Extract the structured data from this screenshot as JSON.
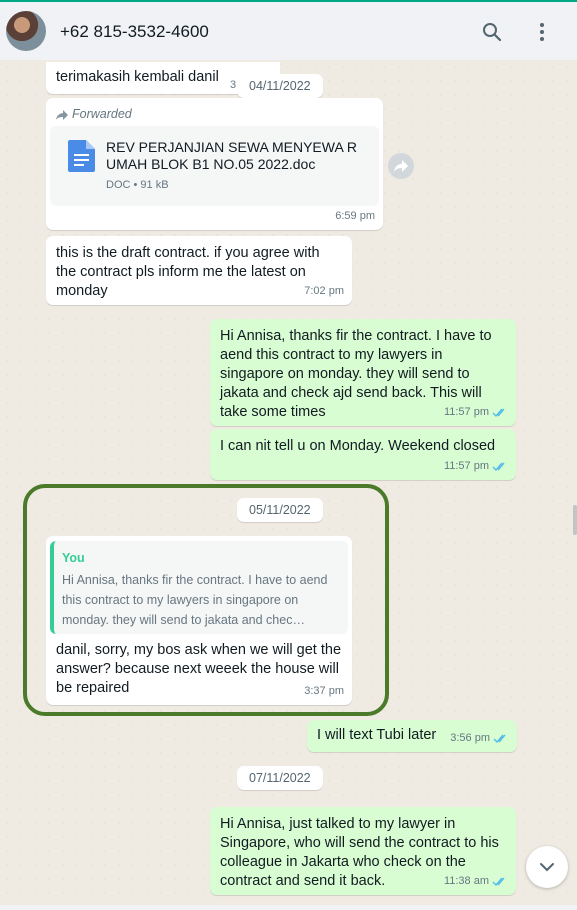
{
  "header": {
    "contact": "+62 815-3532-4600",
    "search_icon": "search-icon",
    "menu_icon": "kebab-menu-icon"
  },
  "colors": {
    "accent": "#00a884",
    "incoming_bubble": "#ffffff",
    "outgoing_bubble": "#d9fdd3",
    "read_ticks": "#53bdeb",
    "highlight_border": "#4a7a2a"
  },
  "messages": {
    "m1": {
      "text": "terimakasih kembali danil",
      "badge": "3"
    },
    "date1": "04/11/2022",
    "m2": {
      "forwarded": "Forwarded",
      "doc_name": "REV PERJANJIAN SEWA MENYEWA RUMAH BLOK B1 NO.05 2022.doc",
      "doc_meta": "DOC • 91 kB",
      "time": "6:59 pm"
    },
    "m3": {
      "text": "this is the draft contract. if you agree with the contract pls inform me the latest on monday",
      "time": "7:02 pm"
    },
    "m4": {
      "text": "Hi Annisa, thanks fir the contract. I have to aend this contract to my lawyers in singapore on monday. they will send to jakata and check ajd send back. This will take some times",
      "time": "11:57 pm"
    },
    "m5": {
      "text": "I can nit tell u on Monday. Weekend closed",
      "time": "11:57 pm"
    },
    "date2": "05/11/2022",
    "m6": {
      "quote_author": "You",
      "quote_text": "Hi Annisa, thanks fir the contract. I have to aend this contract to my lawyers in singapore on monday. they will send to jakata and chec…",
      "text": "danil, sorry, my bos ask when we will get the answer? because next weeek the house will be repaired",
      "time": "3:37 pm"
    },
    "m7": {
      "text": "I will text Tubi later",
      "time": "3:56 pm"
    },
    "date3": "07/11/2022",
    "m8": {
      "text": "Hi Annisa, just talked to my lawyer in Singapore, who will send the contract to his colleague in Jakarta who check on the contract and send it back.",
      "time": "11:38 am"
    }
  }
}
